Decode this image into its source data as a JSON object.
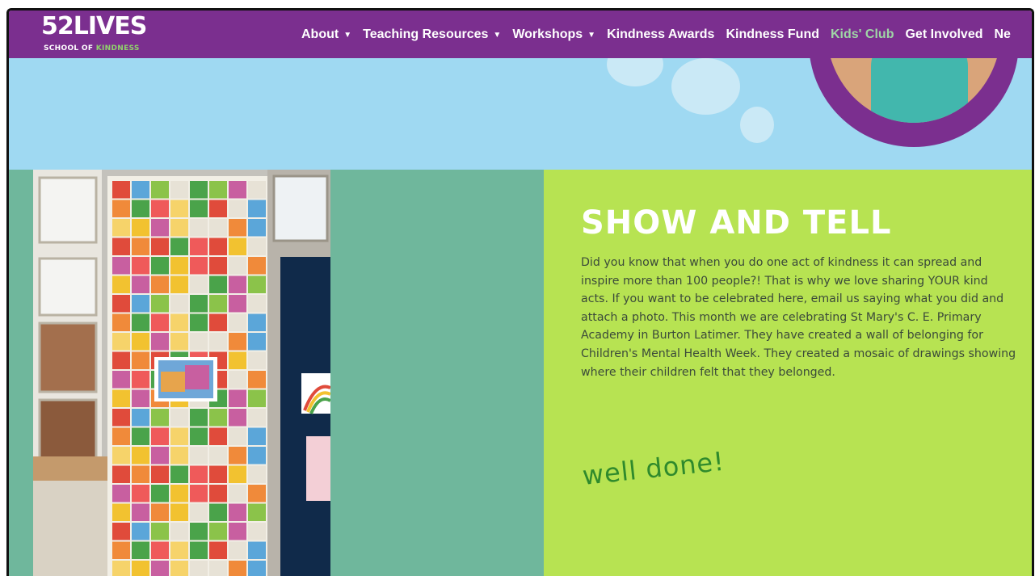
{
  "logo": {
    "main": "52LIVES",
    "sub_prefix": "SCHOOL OF ",
    "sub_highlight": "KINDNESS"
  },
  "nav": {
    "items": [
      {
        "label": "About",
        "dropdown": true
      },
      {
        "label": "Teaching Resources",
        "dropdown": true
      },
      {
        "label": "Workshops",
        "dropdown": true
      },
      {
        "label": "Kindness Awards",
        "dropdown": false
      },
      {
        "label": "Kindness Fund",
        "dropdown": false
      },
      {
        "label": "Kids' Club",
        "dropdown": false,
        "active": true
      },
      {
        "label": "Get Involved",
        "dropdown": false
      },
      {
        "label": "Ne",
        "dropdown": false
      }
    ]
  },
  "section": {
    "heading": "SHOW AND TELL",
    "body": "Did you know that when you do one act of kindness it can spread and inspire more than 100 people?! That is why we love sharing YOUR kind acts. If you want to be celebrated here, email us saying what you did and attach a photo. This month we are celebrating St Mary's C. E. Primary Academy in Burton Latimer. They have created a wall of belonging for Children's Mental Health Week. They created a mosaic of drawings showing where their children felt that they belonged.",
    "signoff": "well done!"
  },
  "colors": {
    "header_purple": "#7b2f8f",
    "hero_blue": "#9fd9f2",
    "teal": "#6fb79c",
    "lime": "#b7e352",
    "active_nav": "#9fd5a6"
  },
  "icons": {
    "nav_dropdown": "chevron-down-icon"
  }
}
